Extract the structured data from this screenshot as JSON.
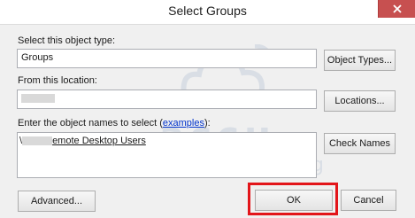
{
  "window": {
    "title": "Select Groups"
  },
  "object_type": {
    "label": "Select this object type:",
    "value": "Groups",
    "button": "Object Types..."
  },
  "location": {
    "label": "From this location:",
    "button": "Locations..."
  },
  "object_names": {
    "label_prefix": "Enter the object names to select (",
    "label_link": "examples",
    "label_suffix": "):",
    "value_start": "\\",
    "value_end": "emote Desktop Users",
    "button": "Check Names"
  },
  "footer": {
    "advanced": "Advanced...",
    "ok": "OK",
    "cancel": "Cancel"
  },
  "watermark": {
    "logo_text": "accu",
    "tagline": "web hosting"
  },
  "colors": {
    "highlight": "#e3151a",
    "close_button": "#c75050",
    "link": "#0033cc"
  }
}
